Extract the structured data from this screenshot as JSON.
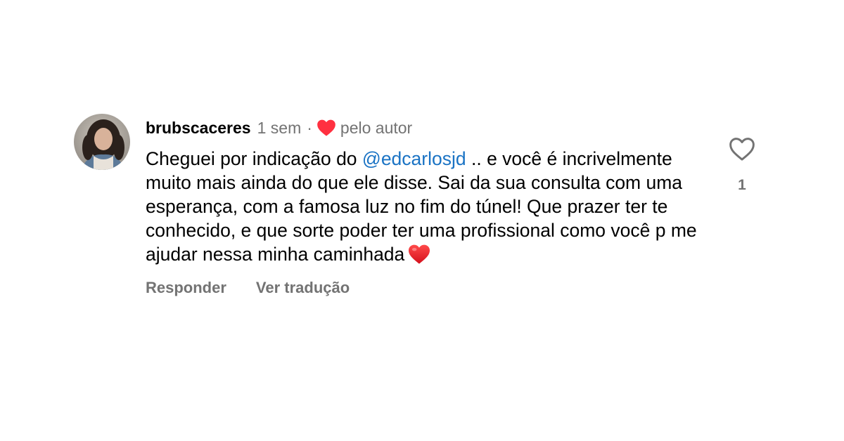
{
  "comment": {
    "username": "brubscaceres",
    "time": "1 sem",
    "separator": "·",
    "liked_by_author_label": "pelo autor",
    "text_before_mention": "Cheguei por indicação do ",
    "mention": "@edcarlosjd",
    "text_after_mention": " .. e você é incrivelmente muito mais ainda do que ele disse. Sai da sua consulta com uma esperança, com a famosa luz no fim do túnel! Que prazer ter te conhecido, e que sorte poder ter uma profissional como você p me ajudar nessa minha caminhada",
    "emoji": "red-heart-emoji",
    "actions": {
      "reply_label": "Responder",
      "translate_label": "Ver tradução"
    },
    "like_count": "1"
  },
  "icons": {
    "liked_heart": "heart-filled-icon",
    "like_button": "heart-outline-icon"
  },
  "colors": {
    "heart_red": "#ff3040",
    "secondary_text": "#737373",
    "mention_blue": "#1a73c4"
  }
}
